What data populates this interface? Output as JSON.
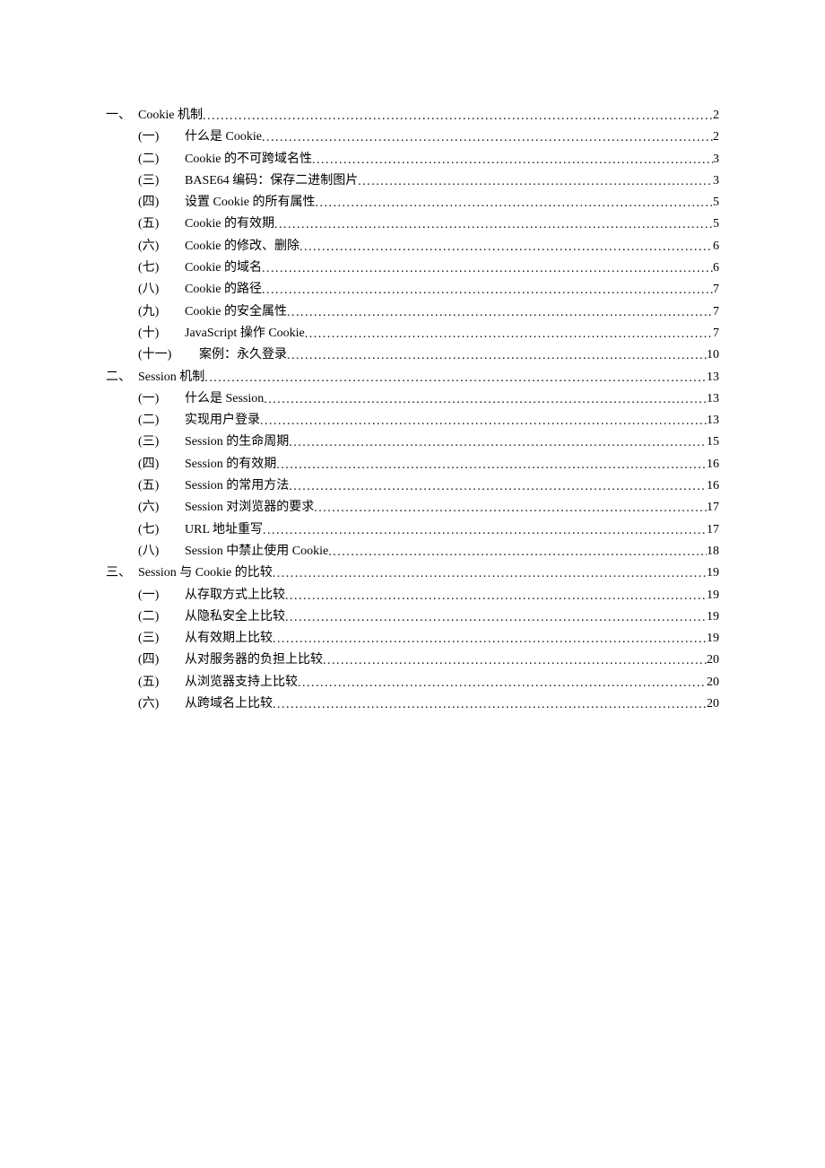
{
  "toc": [
    {
      "level": 1,
      "marker": "一、",
      "title": "Cookie 机制",
      "page": "2"
    },
    {
      "level": 2,
      "marker": "(一)",
      "title": "什么是 Cookie",
      "page": "2"
    },
    {
      "level": 2,
      "marker": "(二)",
      "title": "Cookie 的不可跨域名性",
      "page": "3"
    },
    {
      "level": 2,
      "marker": "(三)",
      "title": "BASE64 编码：保存二进制图片",
      "page": "3"
    },
    {
      "level": 2,
      "marker": "(四)",
      "title": "设置 Cookie 的所有属性",
      "page": "5"
    },
    {
      "level": 2,
      "marker": "(五)",
      "title": "Cookie 的有效期",
      "page": "5"
    },
    {
      "level": 2,
      "marker": "(六)",
      "title": "Cookie 的修改、删除",
      "page": "6"
    },
    {
      "level": 2,
      "marker": "(七)",
      "title": "Cookie 的域名",
      "page": "6"
    },
    {
      "level": 2,
      "marker": "(八)",
      "title": "Cookie 的路径",
      "page": "7"
    },
    {
      "level": 2,
      "marker": "(九)",
      "title": "Cookie 的安全属性",
      "page": "7"
    },
    {
      "level": 2,
      "marker": "(十)",
      "title": "JavaScript 操作 Cookie",
      "page": "7"
    },
    {
      "level": 2,
      "marker": "(十一)",
      "title": "案例：永久登录",
      "page": "10",
      "wide": true
    },
    {
      "level": 1,
      "marker": "二、",
      "title": "Session 机制",
      "page": "13"
    },
    {
      "level": 2,
      "marker": "(一)",
      "title": "什么是 Session",
      "page": "13"
    },
    {
      "level": 2,
      "marker": "(二)",
      "title": "实现用户登录",
      "page": "13"
    },
    {
      "level": 2,
      "marker": "(三)",
      "title": "Session 的生命周期",
      "page": "15"
    },
    {
      "level": 2,
      "marker": "(四)",
      "title": "Session 的有效期",
      "page": "16"
    },
    {
      "level": 2,
      "marker": "(五)",
      "title": "Session 的常用方法",
      "page": "16"
    },
    {
      "level": 2,
      "marker": "(六)",
      "title": "Session 对浏览器的要求",
      "page": "17"
    },
    {
      "level": 2,
      "marker": "(七)",
      "title": "URL 地址重写",
      "page": "17"
    },
    {
      "level": 2,
      "marker": "(八)",
      "title": "Session 中禁止使用 Cookie",
      "page": "18"
    },
    {
      "level": 1,
      "marker": "三、",
      "title": "Session 与 Cookie 的比较",
      "page": "19"
    },
    {
      "level": 2,
      "marker": "(一)",
      "title": "从存取方式上比较",
      "page": "19"
    },
    {
      "level": 2,
      "marker": "(二)",
      "title": "从隐私安全上比较",
      "page": "19"
    },
    {
      "level": 2,
      "marker": "(三)",
      "title": "从有效期上比较",
      "page": "19"
    },
    {
      "level": 2,
      "marker": "(四)",
      "title": "从对服务器的负担上比较",
      "page": "20"
    },
    {
      "level": 2,
      "marker": "(五)",
      "title": "从浏览器支持上比较",
      "page": "20"
    },
    {
      "level": 2,
      "marker": "(六)",
      "title": "从跨域名上比较",
      "page": "20"
    }
  ]
}
